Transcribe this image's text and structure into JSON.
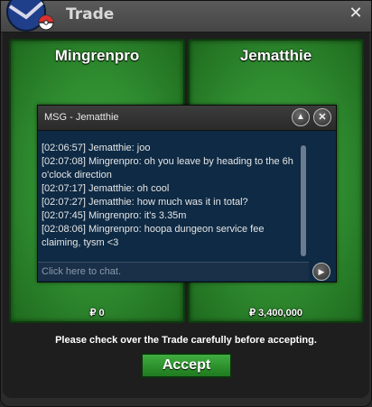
{
  "window": {
    "title": "Trade",
    "close_glyph": "✕"
  },
  "trade": {
    "left_player": {
      "name": "Mingrenpro",
      "money": "₽ 0"
    },
    "right_player": {
      "name": "Jematthie",
      "money": "₽ 3,400,000"
    },
    "notice": "Please check over the Trade carefully before accepting.",
    "accept_label": "Accept"
  },
  "chat": {
    "title": "MSG - Jematthie",
    "minimize_glyph": "▲",
    "close_glyph": "✕",
    "send_glyph": "▶",
    "input_placeholder": "Click here to chat.",
    "messages": [
      "[02:06:57] Jematthie: joo",
      "[02:07:08] Mingrenpro: oh you leave by heading to the 6h o'clock direction",
      "[02:07:17] Jematthie: oh cool",
      "[02:07:27] Jematthie: how much was it in total?",
      "[02:07:45] Mingrenpro: it's 3.35m",
      "[02:08:06] Mingrenpro: hoopa dungeon service fee claiming, tysm <3"
    ]
  },
  "colors": {
    "panel_green": "#2e8a2e",
    "chat_blue": "#0e2a44",
    "accept_green": "#2e9a2e"
  },
  "icons": [
    "pokeball-logo-icon",
    "close-icon",
    "minimize-icon",
    "send-arrow-icon"
  ]
}
